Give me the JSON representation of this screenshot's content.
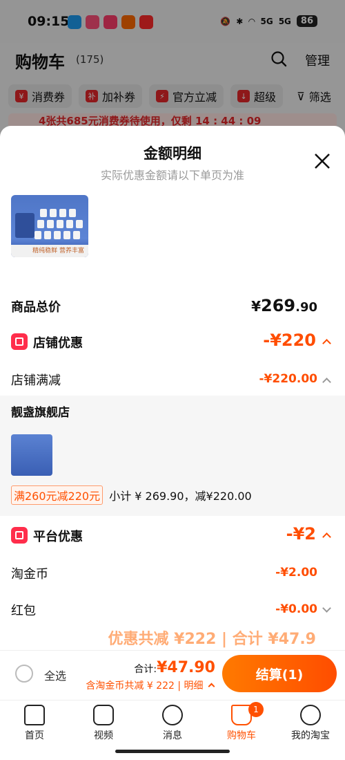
{
  "status_bar": {
    "time": "09:15",
    "battery": "86",
    "net1": "5G",
    "net2": "5G"
  },
  "cart": {
    "title": "购物车",
    "count": "(175)",
    "manage": "管理",
    "filters": [
      "消费券",
      "加补券",
      "官方立减",
      "超级",
      "筛选"
    ],
    "filter_icons": [
      "¥",
      "补",
      "⚡",
      "↓"
    ],
    "banner": "4张共685元消费券待使用，仅剩 14 : 44 : 09"
  },
  "sheet": {
    "title": "金额明细",
    "subtitle": "实际优惠金额请以下单页为准",
    "product_thumb_label": "精纯稳鲜 营养丰富",
    "total_label": "商品总价",
    "total_yen": "¥",
    "total_int": "269",
    "total_dec": ".90",
    "store_discount": {
      "label": "店铺优惠",
      "amount": "-¥220"
    },
    "store_full_reduction": {
      "label": "店铺满减",
      "amount": "-¥220.00"
    },
    "store_name": "靓盏旗舰店",
    "promo_tag": "满260元减220元",
    "subtotal": "小计 ¥ 269.90，减¥220.00",
    "platform_discount": {
      "label": "平台优惠",
      "amount": "-¥2"
    },
    "taojinbi": {
      "label": "淘金币",
      "amount": "-¥2.00"
    },
    "hongbao": {
      "label": "红包",
      "amount": "-¥0.00"
    },
    "summary_peek": "优惠共减 ¥222 | 合计 ¥47.9"
  },
  "checkout": {
    "select_all": "全选",
    "total_label": "合计:",
    "total_value": "¥47.90",
    "discount_text": "含淘金币共减 ¥ 222 | 明细",
    "button": "结算(1)"
  },
  "tabbar": {
    "items": [
      "首页",
      "视频",
      "消息",
      "购物车",
      "我的淘宝"
    ],
    "cart_badge": "1"
  },
  "colors": {
    "accent": "#ff5000",
    "brand_red": "#e5282b"
  }
}
